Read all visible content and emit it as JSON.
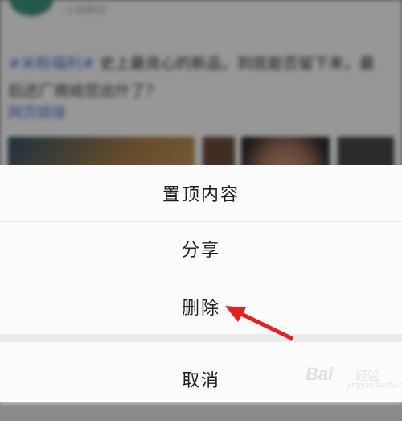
{
  "feed": {
    "author_name": "小米移动",
    "post_tag": "#米粉福利#",
    "post_body": "史上最良心的新品，到底能否留下来，最后还厂商给您出什了？",
    "post_link": "网页链接"
  },
  "action_sheet": {
    "items": [
      {
        "label": "置顶内容"
      },
      {
        "label": "分享"
      },
      {
        "label": "删除"
      }
    ],
    "cancel_label": "取消"
  },
  "annotation": {
    "color": "#e8201c",
    "icon": "red-arrow-icon"
  },
  "watermark": {
    "main": "Bai",
    "sub": "经验",
    "url": "jingyan.baidu.com"
  }
}
